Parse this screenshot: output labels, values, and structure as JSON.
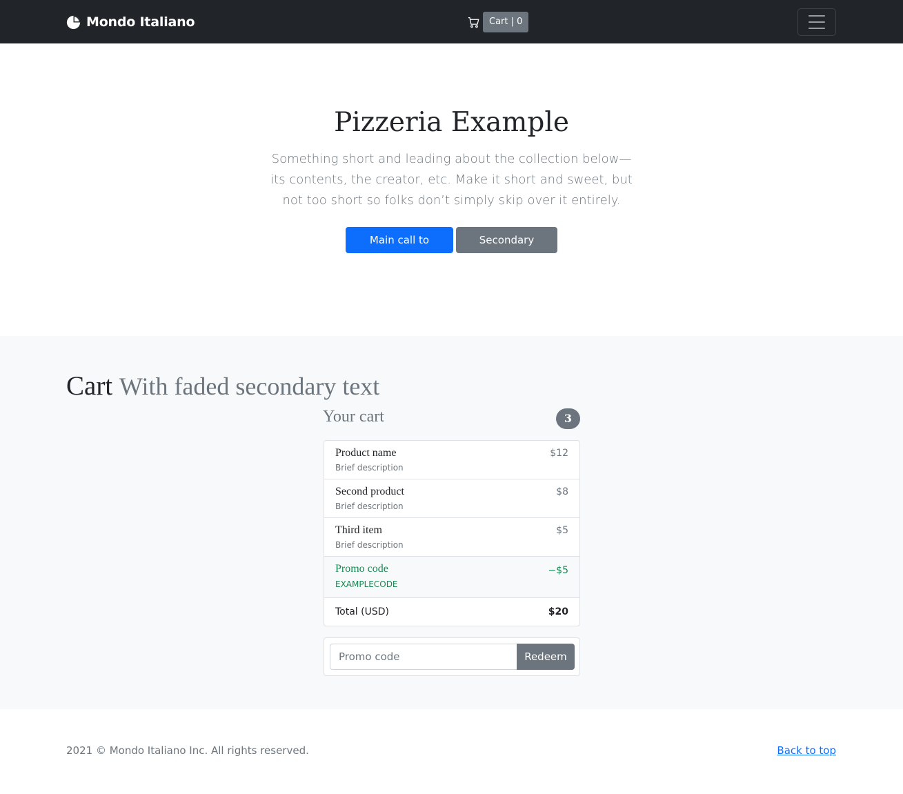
{
  "navbar": {
    "brand": "Mondo Italiano",
    "brand_icon": "pie-chart-icon",
    "cart_icon": "cart-icon",
    "cart_label": "Cart | 0",
    "toggler_icon": "hamburger-icon"
  },
  "hero": {
    "title": "Pizzeria Example",
    "lead": "Something short and leading about the collection below—its contents, the creator, etc. Make it short and sweet, but not too short so folks don’t simply skip over it entirely.",
    "primary_button": "Main call to action",
    "secondary_button": "Secondary action"
  },
  "cart_section": {
    "heading": "Cart",
    "heading_muted": "With faded secondary text",
    "your_cart": "Your cart",
    "count": "3",
    "items": [
      {
        "name": "Product name",
        "description": "Brief description",
        "price": "$12"
      },
      {
        "name": "Second product",
        "description": "Brief description",
        "price": "$8"
      },
      {
        "name": "Third item",
        "description": "Brief description",
        "price": "$5"
      }
    ],
    "promo": {
      "name": "Promo code",
      "code": "EXAMPLECODE",
      "amount": "−$5"
    },
    "total": {
      "label": "Total (USD)",
      "amount": "$20"
    },
    "promo_form": {
      "placeholder": "Promo code",
      "button": "Redeem"
    }
  },
  "footer": {
    "copyright": "2021 © Mondo Italiano Inc. All rights reserved.",
    "back_to_top": "Back to top"
  },
  "colors": {
    "navbar_bg": "#212529",
    "primary": "#0d6efd",
    "secondary": "#6c757d",
    "success": "#198754",
    "light_bg": "#f8f9fa"
  }
}
